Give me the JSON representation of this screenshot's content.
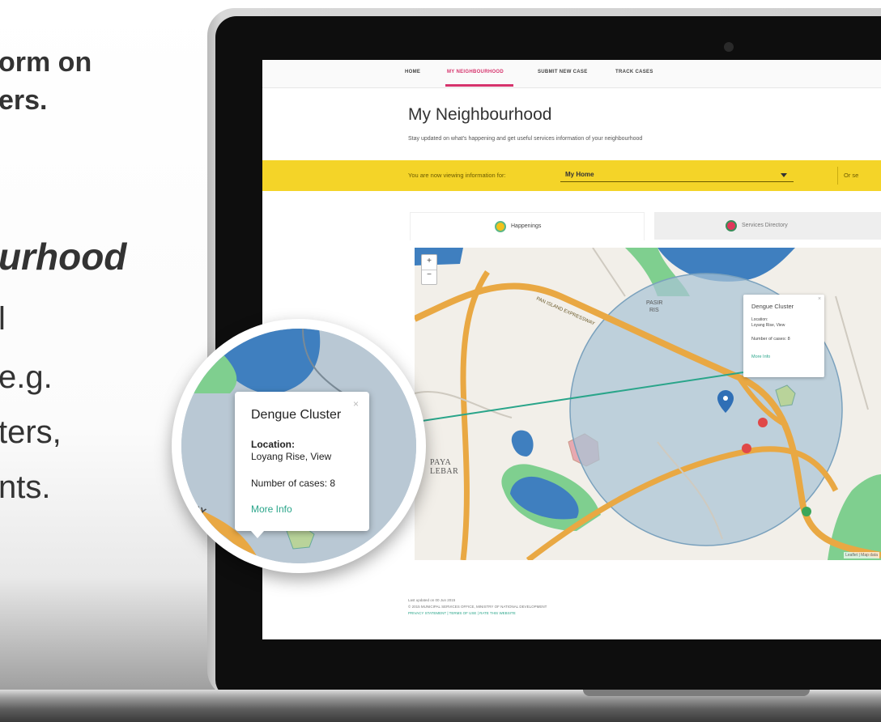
{
  "promo": {
    "line1": "orm on",
    "line2": "ers.",
    "line3": "urhood",
    "line4": "l",
    "line5": "e.g.",
    "line6": "ters,",
    "line7": "nts."
  },
  "nav": {
    "items": [
      "HOME",
      "MY NEIGHBOURHOOD",
      "SUBMIT NEW CASE",
      "TRACK CASES"
    ],
    "active_index": 1
  },
  "page": {
    "title": "My Neighbourhood",
    "subtitle": "Stay updated on what's happening and get useful services information of your neighbourhood"
  },
  "location_bar": {
    "label": "You are now viewing information for:",
    "selected": "My Home",
    "alt_text": "Or se"
  },
  "tabs": [
    {
      "label": "Happenings",
      "icon": "happenings-icon",
      "active": true
    },
    {
      "label": "Services Directory",
      "icon": "services-directory-icon",
      "active": false
    }
  ],
  "map": {
    "zoom_in": "+",
    "zoom_out": "−",
    "attribution": "Leaflet | Map data",
    "place_labels": [
      "PAYA LEBAR",
      "PASIR RIS"
    ],
    "road_label": "PAN ISLAND EXPRESSWAY",
    "small_popup": {
      "title": "Dengue Cluster",
      "location_label": "Location:",
      "location_value": "Loyang Rise, View",
      "cases": "Number of cases: 8",
      "link": "More Info",
      "close": "×"
    }
  },
  "magnifier": {
    "popup": {
      "title": "Dengue Cluster",
      "location_label": "Location:",
      "location_value": "Loyang Rise, View",
      "cases": "Number of cases: 8",
      "link": "More Info",
      "close": "×"
    },
    "labels": [
      "PAYA",
      "LEBAR"
    ]
  },
  "footer": {
    "updated": "Last updated on 00 Jun 2015",
    "copyright": "© 2015 MUNICIPAL SERVICES OFFICE, MINISTRY OF NATIONAL DEVELOPMENT",
    "links": "PRIVACY STATEMENT | TERMS OF USE | RATE THIS WEBSITE"
  },
  "colors": {
    "accent_pink": "#d6336c",
    "banner_yellow": "#f4d428",
    "link_teal": "#2aa58a",
    "road_orange": "#e9a843",
    "water_blue": "#3f7fbf",
    "park_green": "#7fcf8f"
  }
}
